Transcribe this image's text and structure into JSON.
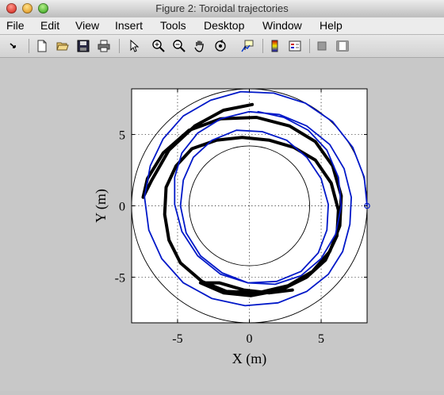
{
  "window": {
    "title": "Figure 2: Toroidal trajectories"
  },
  "menu": [
    "File",
    "Edit",
    "View",
    "Insert",
    "Tools",
    "Desktop",
    "Window",
    "Help"
  ],
  "toolbar": {
    "icons": [
      "arrow-icon",
      "new-figure-icon",
      "open-icon",
      "save-icon",
      "print-icon",
      "select-icon",
      "zoom-in-icon",
      "zoom-out-icon",
      "pan-icon",
      "rotate-icon",
      "data-cursor-icon",
      "colorbar-icon",
      "legend-icon",
      "hide-plot-tools-icon",
      "show-plot-tools-icon"
    ]
  },
  "chart_data": {
    "type": "line",
    "title": "",
    "xlabel": "X (m)",
    "ylabel": "Y (m)",
    "xlim": [
      -8.2,
      8.2
    ],
    "ylim": [
      -8.2,
      8.2
    ],
    "xticks": [
      "-5",
      "0",
      "5"
    ],
    "yticks": [
      "5",
      "0",
      "-5"
    ],
    "xtick_values": [
      -5,
      0,
      5
    ],
    "ytick_values": [
      5,
      0,
      -5
    ],
    "grid": "dotted",
    "reference_circles": [
      {
        "name": "inner boundary",
        "radius": 4.2
      },
      {
        "name": "outer boundary",
        "radius": 8.2
      }
    ],
    "series": [
      {
        "color": "#000000",
        "points": [
          [
            0.2,
            7.1
          ],
          [
            -1.8,
            6.7
          ],
          [
            -3.8,
            5.6
          ],
          [
            -5.6,
            3.9
          ],
          [
            -6.8,
            1.8
          ],
          [
            -7.4,
            0.6
          ],
          [
            -7.1,
            1.9
          ],
          [
            -6.0,
            3.7
          ],
          [
            -4.2,
            5.3
          ],
          [
            -2.0,
            6.1
          ],
          [
            0.5,
            6.2
          ],
          [
            2.8,
            5.6
          ],
          [
            4.6,
            4.5
          ],
          [
            5.8,
            2.8
          ],
          [
            6.4,
            0.7
          ],
          [
            6.3,
            -1.4
          ],
          [
            5.6,
            -3.2
          ],
          [
            4.4,
            -4.6
          ],
          [
            2.7,
            -5.6
          ],
          [
            0.6,
            -6.1
          ],
          [
            -1.6,
            -6.0
          ],
          [
            -3.3,
            -5.3
          ],
          [
            -4.8,
            -4.0
          ],
          [
            -5.6,
            -2.4
          ],
          [
            -5.9,
            -0.6
          ],
          [
            -5.8,
            1.3
          ],
          [
            -5.1,
            2.8
          ],
          [
            -4.0,
            4.0
          ],
          [
            -2.3,
            4.6
          ],
          [
            -0.5,
            4.8
          ],
          [
            1.4,
            4.6
          ],
          [
            3.1,
            4.1
          ],
          [
            4.6,
            3.2
          ],
          [
            5.7,
            1.6
          ],
          [
            6.2,
            -0.3
          ],
          [
            6.1,
            -2.1
          ],
          [
            5.3,
            -3.8
          ],
          [
            4.0,
            -5.0
          ],
          [
            2.2,
            -5.9
          ],
          [
            0.1,
            -6.3
          ],
          [
            -1.8,
            -6.1
          ],
          [
            -3.4,
            -5.4
          ],
          [
            -2.1,
            -5.4
          ],
          [
            -0.4,
            -5.9
          ],
          [
            1.4,
            -6.1
          ],
          [
            3.0,
            -5.9
          ]
        ]
      },
      {
        "color": "#0018c8",
        "points": [
          [
            8.2,
            0
          ],
          [
            8.0,
            2.0
          ],
          [
            7.2,
            4.1
          ],
          [
            5.8,
            5.9
          ],
          [
            3.9,
            7.2
          ],
          [
            1.7,
            7.9
          ],
          [
            -0.6,
            8.0
          ],
          [
            -2.7,
            7.4
          ],
          [
            -4.6,
            6.3
          ],
          [
            -6.0,
            4.7
          ],
          [
            -6.9,
            2.8
          ],
          [
            -7.3,
            0.6
          ],
          [
            -7.0,
            -1.7
          ],
          [
            -6.1,
            -3.7
          ],
          [
            -4.6,
            -5.4
          ],
          [
            -2.6,
            -6.5
          ],
          [
            -0.3,
            -7.0
          ],
          [
            2.0,
            -6.8
          ],
          [
            4.0,
            -6.0
          ],
          [
            5.5,
            -4.8
          ],
          [
            6.5,
            -3.2
          ],
          [
            7.0,
            -1.3
          ],
          [
            7.1,
            0.6
          ],
          [
            6.6,
            2.6
          ],
          [
            5.6,
            4.3
          ],
          [
            4.0,
            5.6
          ],
          [
            2.1,
            6.4
          ],
          [
            0.0,
            6.6
          ],
          [
            -2.0,
            6.1
          ],
          [
            -3.6,
            5.1
          ],
          [
            -4.7,
            3.7
          ],
          [
            -5.2,
            2.0
          ],
          [
            -5.2,
            0.1
          ],
          [
            -4.7,
            -1.8
          ],
          [
            -3.6,
            -3.5
          ],
          [
            -2.0,
            -4.8
          ],
          [
            -0.1,
            -5.4
          ],
          [
            1.9,
            -5.3
          ],
          [
            3.6,
            -4.6
          ],
          [
            4.8,
            -3.3
          ],
          [
            5.4,
            -1.7
          ],
          [
            5.5,
            0.1
          ],
          [
            5.0,
            1.9
          ],
          [
            4.0,
            3.4
          ],
          [
            2.6,
            4.6
          ],
          [
            0.9,
            5.2
          ],
          [
            -0.9,
            5.3
          ],
          [
            -2.6,
            4.6
          ],
          [
            -3.9,
            3.4
          ],
          [
            -4.6,
            1.8
          ],
          [
            -4.8,
            0.0
          ],
          [
            -4.4,
            -1.9
          ],
          [
            -3.4,
            -3.5
          ],
          [
            -1.9,
            -4.7
          ],
          [
            -0.1,
            -5.4
          ],
          [
            1.8,
            -5.5
          ],
          [
            3.6,
            -4.9
          ],
          [
            5.0,
            -3.7
          ],
          [
            6.0,
            -2.0
          ],
          [
            6.4,
            0.0
          ],
          [
            6.2,
            2.0
          ],
          [
            5.4,
            3.9
          ],
          [
            4.1,
            5.3
          ],
          [
            2.4,
            6.2
          ],
          [
            0.6,
            6.6
          ]
        ]
      }
    ],
    "start_marker": {
      "x": 8.2,
      "y": 0,
      "color": "#0018c8"
    }
  }
}
